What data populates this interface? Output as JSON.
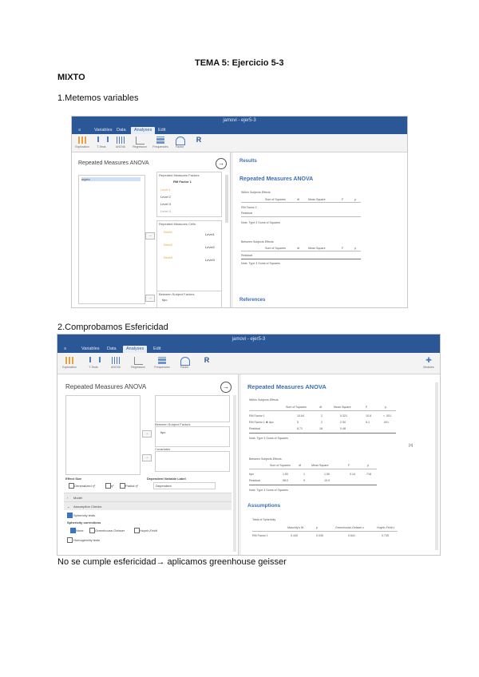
{
  "doc": {
    "heading": "TEMA 5: Ejercicio 5-3",
    "subheading": "MIXTO",
    "step1": "1.Metemos variables",
    "step2": "2.Comprobamos Esfericidad",
    "conclusion": "No se cumple esfericidad→ aplicamos greenhouse geisser"
  },
  "shot1": {
    "title": "jamovi - ejer5-3",
    "menu": [
      "≡",
      "Variables",
      "Data",
      "Analyses",
      "Edit"
    ],
    "active_menu": 3,
    "tools": [
      "Exploration",
      "T-Tests",
      "ANOVA",
      "Regression",
      "Frequencies",
      "Factor",
      "R"
    ],
    "panel_title": "Repeated Measures ANOVA",
    "var_item": "sujeto",
    "rm_factors_title": "Repeated Measures Factors",
    "rm_factor_name": "RM Factor 1",
    "levels": [
      "Level 1",
      "Level 2",
      "Level 3",
      "Level 4"
    ],
    "rm_cells_title": "Repeated Measures Cells",
    "cells": [
      "Nivel1",
      "Nivel2",
      "Nivel3"
    ],
    "cell_tags": [
      "Level1",
      "Level2",
      "Level3"
    ],
    "between_title": "Between Subject Factors",
    "between_item": "tipo",
    "results_label": "Results",
    "anova_title": "Repeated Measures ANOVA",
    "within_label": "Within Subjects Effects",
    "within_header": [
      "Sum of Squares",
      "df",
      "Mean Square",
      "F",
      "p"
    ],
    "within_rows": [
      "RM Factor 1",
      "Residual"
    ],
    "within_note": "Note. Type 3 Sums of Squares",
    "between_label": "Between Subjects Effects",
    "between_header": [
      "Sum of Squares",
      "df",
      "Mean Square",
      "F",
      "p"
    ],
    "between_rows": [
      "Residual"
    ],
    "between_note": "Note. Type 3 Sums of Squares",
    "references": "References"
  },
  "shot2": {
    "title": "jamovi - ejer5-3",
    "menu": [
      "≡",
      "Variables",
      "Data",
      "Analyses",
      "Edit"
    ],
    "active_menu": 3,
    "tools": [
      "Exploration",
      "T-Tests",
      "ANOVA",
      "Regression",
      "Frequencies",
      "Factor",
      "R"
    ],
    "right_tool": "Modules",
    "panel_title": "Repeated Measures ANOVA",
    "between_title": "Between Subject Factors",
    "between_item": "tipo",
    "covariates_title": "Covariates",
    "effect_size": "Effect Size",
    "dep_var_label": "Dependent Variable Label",
    "es_options": [
      "Generalized η²",
      "η²",
      "Partial η²"
    ],
    "dep_var_value": "Dependent",
    "model": "Model",
    "assumption_checks": "Assumption Checks",
    "sphericity_tests": "Sphericity tests",
    "sphericity_corrections": "Sphericity corrections",
    "corrections": [
      "None",
      "Greenhouse-Geisser",
      "Huynh-Feldt"
    ],
    "homogeneity": "Homogeneity tests",
    "anova_title": "Repeated Measures ANOVA",
    "within_label": "Within Subjects Effects",
    "within_header": [
      "Sum of Squares",
      "df",
      "Mean Square",
      "F",
      "p"
    ],
    "within_rows": [
      {
        "label": "RM Factor 1",
        "ss": "10.64",
        "df": "2",
        "ms": "5.321",
        "f": "10.8",
        "p": "< .001"
      },
      {
        "label": "RM Factor 1 ✱ tipo",
        "ss": "5",
        "df": "2",
        "ms": "2.50",
        "f": "5.1",
        "p": ".001"
      },
      {
        "label": "Residual",
        "ss": "8.71",
        "df": "18",
        "ms": "0.48",
        "f": "",
        "p": ""
      }
    ],
    "within_note": "Note. Type 3 Sums of Squares",
    "page_no": "[3]",
    "between_label": "Between Subjects Effects",
    "between_header": [
      "Sum of Squares",
      "df",
      "Mean Square",
      "F",
      "p"
    ],
    "between_rows": [
      {
        "label": "tipo",
        "ss": "1.50",
        "df": "1",
        "ms": "1.50",
        "f": "0.14",
        "p": ".718"
      },
      {
        "label": "Residual",
        "ss": "98.0",
        "df": "9",
        "ms": "10.9",
        "f": "",
        "p": ""
      }
    ],
    "between_note": "Note. Type 3 Sums of Squares",
    "assumptions_title": "Assumptions",
    "sphericity_label": "Tests of Sphericity",
    "sph_header": [
      "Mauchly's W",
      "p",
      "Greenhouse-Geisser ε",
      "Huynh-Feldt ε"
    ],
    "sph_row": {
      "label": "RM Factor 1",
      "w": "0.440",
      "p": "0.035",
      "gg": "0.641",
      "hf": "0.735"
    }
  },
  "colors": {
    "accent": "#2b5797",
    "results_blue": "#3a6fb7"
  }
}
